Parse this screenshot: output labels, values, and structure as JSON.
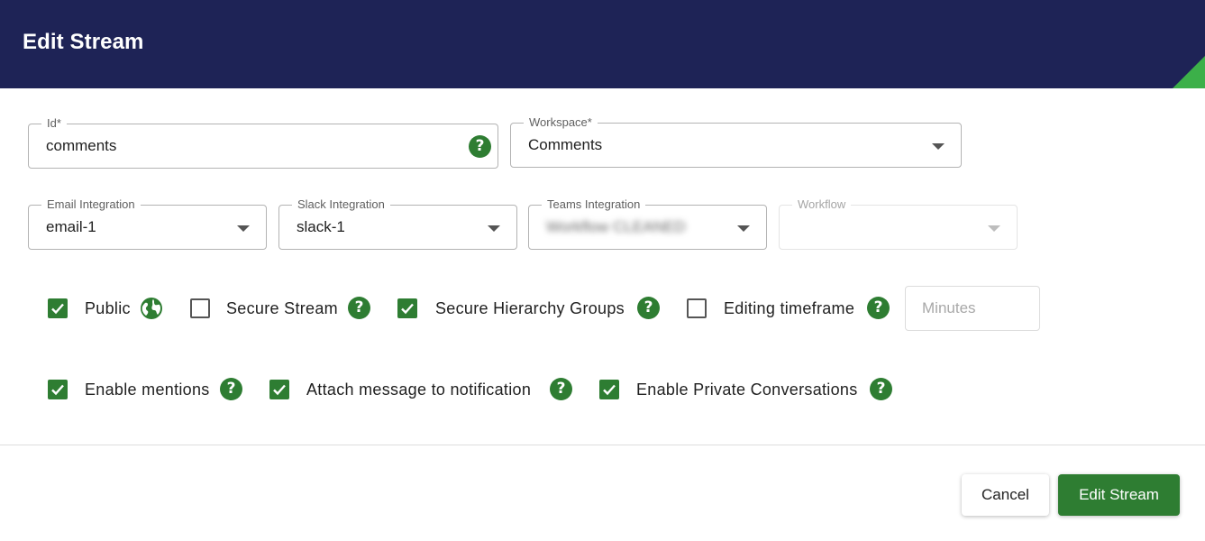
{
  "header": {
    "title": "Edit Stream"
  },
  "fields": {
    "id": {
      "label": "Id*",
      "value": "comments"
    },
    "workspace": {
      "label": "Workspace*",
      "value": "Comments"
    },
    "email": {
      "label": "Email Integration",
      "value": "email-1"
    },
    "slack": {
      "label": "Slack Integration",
      "value": "slack-1"
    },
    "teams": {
      "label": "Teams Integration",
      "value": "Workflow CLEANED"
    },
    "workflow": {
      "label": "Workflow",
      "value": ""
    }
  },
  "options_row1": [
    {
      "label": "Public",
      "checked": true,
      "icon": "globe-icon"
    },
    {
      "label": "Secure Stream",
      "checked": false,
      "icon": "help-icon"
    },
    {
      "label": "Secure Hierarchy Groups",
      "checked": true,
      "icon": "help-icon"
    },
    {
      "label": "Editing timeframe",
      "checked": false,
      "icon": "help-icon"
    }
  ],
  "minutes": {
    "placeholder": "Minutes",
    "value": ""
  },
  "options_row2": [
    {
      "label": "Enable mentions",
      "checked": true,
      "icon": "help-icon"
    },
    {
      "label": "Attach message to notification",
      "checked": true,
      "icon": "help-icon"
    },
    {
      "label": "Enable Private Conversations",
      "checked": true,
      "icon": "help-icon"
    }
  ],
  "footer": {
    "cancel_label": "Cancel",
    "submit_label": "Edit Stream"
  },
  "colors": {
    "header_bg": "#1e2356",
    "accent": "#2e7d32",
    "corner": "#3cb049"
  },
  "help_glyph": "?"
}
